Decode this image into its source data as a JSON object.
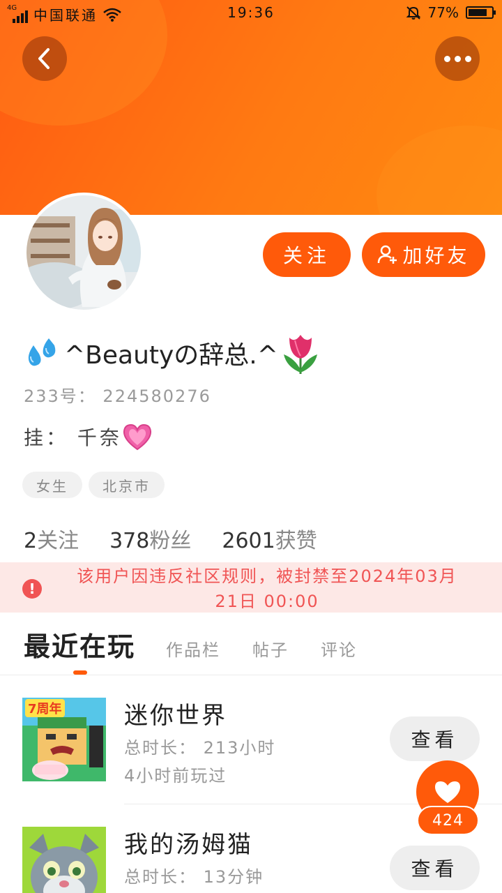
{
  "status_bar": {
    "network": "4G",
    "carrier": "中国联通",
    "time": "19:36",
    "battery": "77%"
  },
  "profile": {
    "nickname": "^Beautyの辞总.^",
    "uid": "233号：  224580276",
    "signature": "挂： 千奈",
    "tags": [
      "女生",
      "北京市"
    ],
    "stats": {
      "following_count": "2",
      "following_label": "关注",
      "fans_count": "378",
      "fans_label": "粉丝",
      "likes_count": "2601",
      "likes_label": "获赞"
    }
  },
  "actions": {
    "follow_label": "关注",
    "add_friend_label": "加好友"
  },
  "ban_notice": {
    "line1": "该用户因违反社区规则，被封禁至2024年03月",
    "line2": "21日 00:00",
    "color": "#f05454"
  },
  "tabs": [
    {
      "label": "最近在玩",
      "active": true
    },
    {
      "label": "作品栏",
      "active": false
    },
    {
      "label": "帖子",
      "active": false
    },
    {
      "label": "评论",
      "active": false
    }
  ],
  "games": [
    {
      "name": "迷你世界",
      "total_time": "总时长：  213小时",
      "last_played": "4小时前玩过",
      "view_label": "查看",
      "badge": "7周年"
    },
    {
      "name": "我的汤姆猫",
      "total_time": "总时长：  13分钟",
      "view_label": "查看"
    }
  ],
  "floating_like": {
    "count": "424",
    "icon": "heart-icon"
  },
  "colors": {
    "accent": "#ff5a0a",
    "header_gradient_start": "#ff5a12",
    "header_gradient_end": "#ff8a10"
  }
}
